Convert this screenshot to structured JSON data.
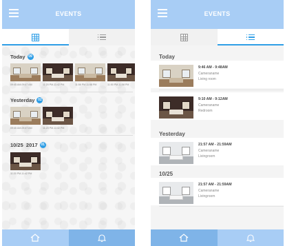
{
  "colors": {
    "header": "#a8cdf5",
    "accent": "#2e9ee6",
    "nav_dark": "#7fb4e8"
  },
  "grid_screen": {
    "title": "EVENTS",
    "sections": [
      {
        "title": "Today",
        "badge": "09",
        "thumbs": [
          {
            "time": "09:45 AM-09:47 AM",
            "style": "living"
          },
          {
            "time": "11:20 PM-11:42 PM",
            "style": "dark"
          },
          {
            "time": "11:56 PM-11:58 PM",
            "style": "living"
          },
          {
            "time": "11:50 PM-11:58 PM",
            "style": "dark"
          }
        ]
      },
      {
        "title": "Yesterday",
        "badge": "02",
        "thumbs": [
          {
            "time": "09:45 AM-09:47 AM",
            "style": "living"
          },
          {
            "time": "11:20 PM-11:42 PM",
            "style": "dark"
          }
        ]
      },
      {
        "title": "10/25  2017",
        "badge": "01",
        "thumbs": [
          {
            "time": "11:20 PM-11:42 PM",
            "style": "dark"
          }
        ]
      }
    ],
    "icons": {
      "menu": "menu-icon",
      "grid": "grid-icon",
      "list": "list-icon",
      "home": "home-icon",
      "bell": "bell-icon"
    }
  },
  "list_screen": {
    "title": "EVENTS",
    "sections": [
      {
        "title": "Today",
        "rows": [
          {
            "time_range": "9:46 AM - 9:48AM",
            "camera": "Cameraname",
            "room": "Living room",
            "style": "living"
          },
          {
            "time_range": "9:10 AM - 9:12AM",
            "camera": "Cameraname",
            "room": "Redroom",
            "style": "dark"
          }
        ]
      },
      {
        "title": "Yesterday",
        "rows": [
          {
            "time_range": "21:57 AM - 21:59AM",
            "camera": "Cameraname",
            "room": "Livingroom",
            "style": "bright"
          }
        ]
      },
      {
        "title": "10/25",
        "rows": [
          {
            "time_range": "21:57 AM - 21:59AM",
            "camera": "Cameraname",
            "room": "Livingroom",
            "style": "bright"
          }
        ]
      }
    ]
  }
}
